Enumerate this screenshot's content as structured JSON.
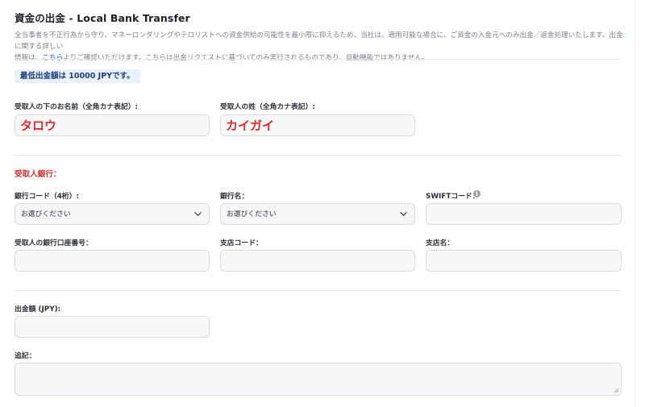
{
  "header": {
    "title": "資金の出金 - Local Bank Transfer",
    "description_line1": "全当事者を不正行為から守り、マネーロンダリングやテロリストへの資金供給の可能性を最小限に抑えるため、当社は、適用可能な場合に、ご資金の入金元へのみ出金／返金処理いたします。出金に関する詳しい",
    "description_line2_pre": "情報は、",
    "description_link": "こちら",
    "description_line2_post": "よりご確認いただけます。こちらは出金リクエストに基づいてのみ実行されるものであり、自動機能ではありません。"
  },
  "notice": {
    "min_withdrawal": "最低出金額は 10000 JPYです。"
  },
  "recipient": {
    "first_name_label": "受取人の下のお名前（全角カナ表記）:",
    "first_name_value": "タロウ",
    "last_name_label": "受取人の姓（全角カナ表記）:",
    "last_name_value": "カイガイ"
  },
  "bank": {
    "section_title": "受取人銀行：",
    "bank_code_label": "銀行コード（4桁）:",
    "bank_code_selected": "お選びください",
    "bank_name_label": "銀行名：",
    "bank_name_selected": "お選びください",
    "swift_label": "SWIFTコード：",
    "swift_value": "",
    "account_number_label": "受取人の銀行口座番号：",
    "account_number_value": "",
    "branch_code_label": "支店コード：",
    "branch_code_value": "",
    "branch_name_label": "支店名：",
    "branch_name_value": ""
  },
  "amount": {
    "label": "出金額 (JPY):",
    "value": ""
  },
  "notes": {
    "label": "追記：",
    "value": ""
  },
  "icons": {
    "info": "info-icon",
    "chevron": "chevron-down-icon",
    "resize": "resize-grip-icon"
  },
  "colors": {
    "accent_red": "#e12727",
    "link": "#1f5ec9",
    "badge_bg": "#e8f1fd"
  }
}
